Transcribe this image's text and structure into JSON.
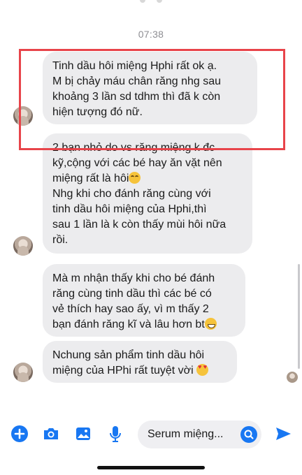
{
  "conversation": {
    "timestamp": "07:38",
    "messages": [
      {
        "lines": [
          "Tinh dầu hôi miệng Hphi rất ok ạ.",
          "M bị chảy máu chân răng nhg sau",
          "khoảng 3 lần sd tdhm thì đã k còn",
          "hiện tượng đó nữ."
        ]
      },
      {
        "lines": [
          "2 bạn nhỏ do vs răng miệng k đc",
          "kỹ,cộng với các bé hay ăn vặt nên",
          "miệng rất là hôi",
          "Nhg khi cho đánh răng cùng với",
          "tinh dầu hôi miệng của Hphi,thì",
          "sau 1 lần là k còn thấy mùi hôi nữa",
          "rồi."
        ],
        "emoji_after_line_3": "crying-face-emoji"
      },
      {
        "lines": [
          "Mà m nhận thấy khi cho bé đánh",
          "răng cùng tinh dầu thì các bé có",
          "vẻ thích hay sao ấy, vì m thấy 2",
          "bạn đánh răng kĩ và lâu hơn bt"
        ],
        "emoji_after_line_4": "grinning-face-emoji"
      },
      {
        "lines": [
          "Nchung sản phẩm tinh dầu hôi",
          "miệng của HPhi rất tuyệt vời"
        ],
        "emoji_after_line_2": "heart-eyes-emoji"
      }
    ]
  },
  "composer": {
    "input_text": "Serum miệng...",
    "icons": [
      "plus-icon",
      "camera-icon",
      "gallery-icon",
      "microphone-icon",
      "search-icon",
      "send-icon"
    ]
  },
  "colors": {
    "bubble": "#ececee",
    "accent": "#1877f2",
    "highlight": "#e8444a"
  }
}
